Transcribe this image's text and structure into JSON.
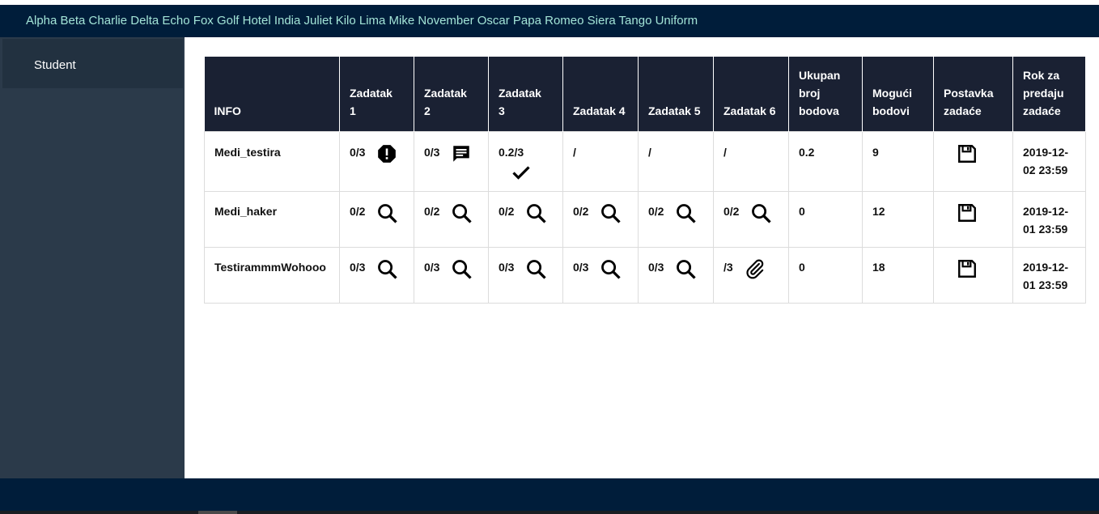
{
  "header": {
    "title": "Alpha Beta Charlie Delta Echo Fox Golf Hotel India Juliet Kilo Lima Mike November Oscar Papa Romeo Siera Tango Uniform"
  },
  "sidebar": {
    "items": [
      {
        "label": "Student"
      }
    ]
  },
  "table": {
    "headers": [
      "INFO",
      "Zadatak\n1",
      "Zadatak\n2",
      "Zadatak\n3",
      "Zadatak 4",
      "Zadatak 5",
      "Zadatak 6",
      "Ukupan\nbroj\nbodova",
      "Mogući\nbodovi",
      "Postavka\nzadaće",
      "Rok za\npredaju\nzadaće"
    ],
    "rows": [
      {
        "info": "Medi_testira",
        "tasks": [
          {
            "score": "0/3",
            "icon": "alert-octagon-icon"
          },
          {
            "score": "0/3",
            "icon": "comment-icon"
          },
          {
            "score": "0.2/3",
            "icon": "check-icon"
          },
          {
            "score": "/",
            "icon": ""
          },
          {
            "score": "/",
            "icon": ""
          },
          {
            "score": "/",
            "icon": ""
          }
        ],
        "total": "0.2",
        "possible": "9",
        "assignment_icon": "save-icon",
        "deadline": "2019-12-\n02 23:59"
      },
      {
        "info": "Medi_haker",
        "tasks": [
          {
            "score": "0/2",
            "icon": "search-icon"
          },
          {
            "score": "0/2",
            "icon": "search-icon"
          },
          {
            "score": "0/2",
            "icon": "search-icon"
          },
          {
            "score": "0/2",
            "icon": "search-icon"
          },
          {
            "score": "0/2",
            "icon": "search-icon"
          },
          {
            "score": "0/2",
            "icon": "search-icon"
          }
        ],
        "total": "0",
        "possible": "12",
        "assignment_icon": "save-icon",
        "deadline": "2019-12-\n01 23:59"
      },
      {
        "info": "TestirammmWohooo",
        "tasks": [
          {
            "score": "0/3",
            "icon": "search-icon"
          },
          {
            "score": "0/3",
            "icon": "search-icon"
          },
          {
            "score": "0/3",
            "icon": "search-icon"
          },
          {
            "score": "0/3",
            "icon": "search-icon"
          },
          {
            "score": "0/3",
            "icon": "search-icon"
          },
          {
            "score": "/3",
            "icon": "paperclip-icon"
          }
        ],
        "total": "0",
        "possible": "18",
        "assignment_icon": "save-icon",
        "deadline": "2019-12-\n01 23:59"
      }
    ]
  },
  "colors": {
    "header_bg": "#001d3a",
    "header_text": "#a3e4d7",
    "sidebar_bg": "#2b3a4a",
    "table_head_bg": "#1a2133"
  }
}
